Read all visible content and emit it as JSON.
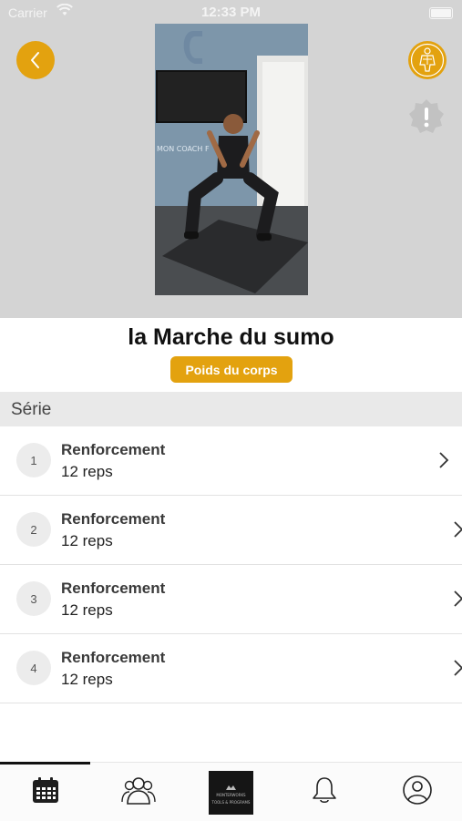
{
  "status_bar": {
    "carrier": "Carrier",
    "time": "12:33 PM"
  },
  "exercise": {
    "title": "la Marche du sumo",
    "badge": "Poids du corps",
    "video_wall_text": "MON COACH F"
  },
  "sets": {
    "header": "Série",
    "items": [
      {
        "number": "1",
        "label": "Renforcement",
        "reps": "12 reps"
      },
      {
        "number": "2",
        "label": "Renforcement",
        "reps": "12 reps"
      },
      {
        "number": "3",
        "label": "Renforcement",
        "reps": "12 reps"
      },
      {
        "number": "4",
        "label": "Renforcement",
        "reps": "12 reps"
      }
    ]
  },
  "tabbar": {
    "items": [
      "calendar-icon",
      "community-icon",
      "brand-logo",
      "bell-icon",
      "profile-icon"
    ],
    "logo_text": "MONTERWORKS",
    "logo_subtext": "TOOLS & PROGRAMS"
  },
  "colors": {
    "accent": "#e3a20f",
    "hero_bg": "#d4d4d4",
    "section_bg": "#e9e9e9"
  }
}
